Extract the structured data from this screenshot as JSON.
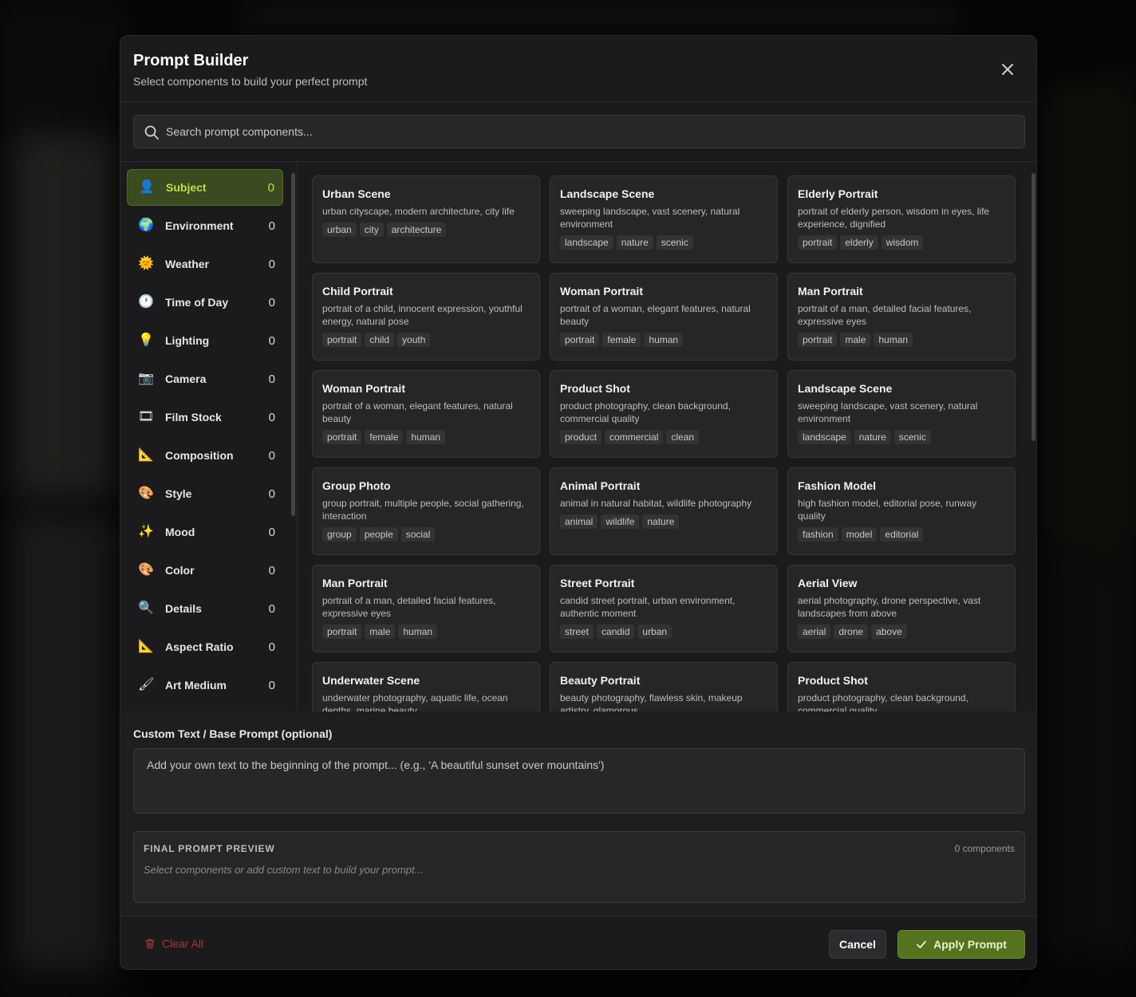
{
  "colors": {
    "accent": "#b8e04a",
    "accent_bg": "#3b4a1f",
    "apply_bg": "#55721f",
    "danger": "#a2382f",
    "modal_bg": "#1b1b1d",
    "card_bg": "#262628"
  },
  "header": {
    "title": "Prompt Builder",
    "subtitle": "Select components to build your perfect prompt",
    "close_icon": "close-icon"
  },
  "search": {
    "placeholder": "Search prompt components...",
    "value": "",
    "icon": "search-icon"
  },
  "categories": [
    {
      "label": "Subject",
      "count": "0",
      "icon": "person-icon",
      "glyph": "👤",
      "active": true
    },
    {
      "label": "Environment",
      "count": "0",
      "icon": "globe-icon",
      "glyph": "🌍"
    },
    {
      "label": "Weather",
      "count": "0",
      "icon": "sun-icon",
      "glyph": "🌞"
    },
    {
      "label": "Time of Day",
      "count": "0",
      "icon": "clock-icon",
      "glyph": "🕐"
    },
    {
      "label": "Lighting",
      "count": "0",
      "icon": "bulb-icon",
      "glyph": "💡"
    },
    {
      "label": "Camera",
      "count": "0",
      "icon": "camera-icon",
      "glyph": "📷"
    },
    {
      "label": "Film Stock",
      "count": "0",
      "icon": "film-icon",
      "glyph": "🎞"
    },
    {
      "label": "Composition",
      "count": "0",
      "icon": "ruler-triangle-icon",
      "glyph": "📐"
    },
    {
      "label": "Style",
      "count": "0",
      "icon": "palette-icon",
      "glyph": "🎨"
    },
    {
      "label": "Mood",
      "count": "0",
      "icon": "sparkles-icon",
      "glyph": "✨"
    },
    {
      "label": "Color",
      "count": "0",
      "icon": "palette-icon",
      "glyph": "🎨"
    },
    {
      "label": "Details",
      "count": "0",
      "icon": "magnifier-icon",
      "glyph": "🔍"
    },
    {
      "label": "Aspect Ratio",
      "count": "0",
      "icon": "ruler-triangle-icon",
      "glyph": "📐"
    },
    {
      "label": "Art Medium",
      "count": "0",
      "icon": "brush-icon",
      "glyph": "🖌"
    }
  ],
  "cards": [
    {
      "title": "Urban Scene",
      "desc": "urban cityscape, modern architecture, city life",
      "tags": [
        "urban",
        "city",
        "architecture"
      ]
    },
    {
      "title": "Landscape Scene",
      "desc": "sweeping landscape, vast scenery, natural environment",
      "tags": [
        "landscape",
        "nature",
        "scenic"
      ]
    },
    {
      "title": "Elderly Portrait",
      "desc": "portrait of elderly person, wisdom in eyes, life experience, dignified",
      "tags": [
        "portrait",
        "elderly",
        "wisdom"
      ]
    },
    {
      "title": "Child Portrait",
      "desc": "portrait of a child, innocent expression, youthful energy, natural pose",
      "tags": [
        "portrait",
        "child",
        "youth"
      ]
    },
    {
      "title": "Woman Portrait",
      "desc": "portrait of a woman, elegant features, natural beauty",
      "tags": [
        "portrait",
        "female",
        "human"
      ]
    },
    {
      "title": "Man Portrait",
      "desc": "portrait of a man, detailed facial features, expressive eyes",
      "tags": [
        "portrait",
        "male",
        "human"
      ]
    },
    {
      "title": "Woman Portrait",
      "desc": "portrait of a woman, elegant features, natural beauty",
      "tags": [
        "portrait",
        "female",
        "human"
      ]
    },
    {
      "title": "Product Shot",
      "desc": "product photography, clean background, commercial quality",
      "tags": [
        "product",
        "commercial",
        "clean"
      ]
    },
    {
      "title": "Landscape Scene",
      "desc": "sweeping landscape, vast scenery, natural environment",
      "tags": [
        "landscape",
        "nature",
        "scenic"
      ]
    },
    {
      "title": "Group Photo",
      "desc": "group portrait, multiple people, social gathering, interaction",
      "tags": [
        "group",
        "people",
        "social"
      ]
    },
    {
      "title": "Animal Portrait",
      "desc": "animal in natural habitat, wildlife photography",
      "tags": [
        "animal",
        "wildlife",
        "nature"
      ]
    },
    {
      "title": "Fashion Model",
      "desc": "high fashion model, editorial pose, runway quality",
      "tags": [
        "fashion",
        "model",
        "editorial"
      ]
    },
    {
      "title": "Man Portrait",
      "desc": "portrait of a man, detailed facial features, expressive eyes",
      "tags": [
        "portrait",
        "male",
        "human"
      ]
    },
    {
      "title": "Street Portrait",
      "desc": "candid street portrait, urban environment, authentic moment",
      "tags": [
        "street",
        "candid",
        "urban"
      ]
    },
    {
      "title": "Aerial View",
      "desc": "aerial photography, drone perspective, vast landscapes from above",
      "tags": [
        "aerial",
        "drone",
        "above"
      ]
    },
    {
      "title": "Underwater Scene",
      "desc": "underwater photography, aquatic life, ocean depths, marine beauty",
      "tags": []
    },
    {
      "title": "Beauty Portrait",
      "desc": "beauty photography, flawless skin, makeup artistry, glamorous",
      "tags": []
    },
    {
      "title": "Product Shot",
      "desc": "product photography, clean background, commercial quality",
      "tags": []
    }
  ],
  "custom": {
    "label": "Custom Text / Base Prompt (optional)",
    "placeholder": "Add your own text to the beginning of the prompt... (e.g., 'A beautiful sunset over mountains')",
    "value": ""
  },
  "preview": {
    "title": "FINAL PROMPT PREVIEW",
    "count": "0 components",
    "empty_text": "Select components or add custom text to build your prompt..."
  },
  "footer": {
    "clear_label": "Clear All",
    "cancel_label": "Cancel",
    "apply_label": "Apply Prompt"
  }
}
